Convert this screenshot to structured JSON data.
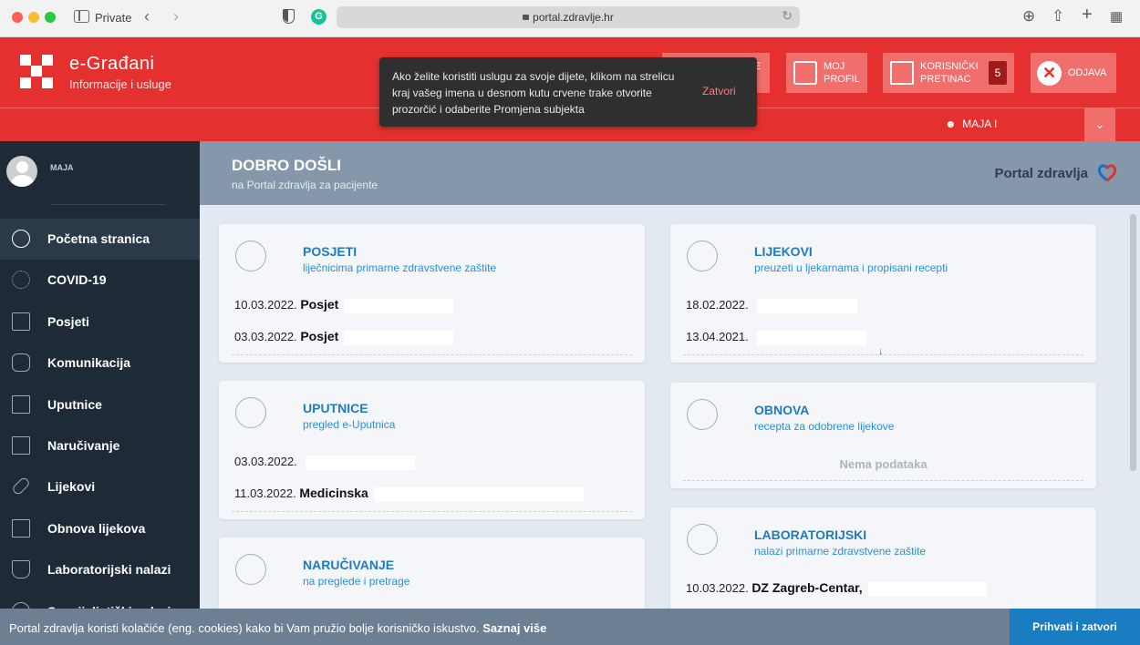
{
  "browser": {
    "private_label": "Private",
    "url": "portal.zdravlje.hr"
  },
  "header": {
    "app_name": "e-Građani",
    "app_subtitle": "Informacije i usluge",
    "hidden_button_label": "E",
    "profile_label": "MOJ\nPROFIL",
    "inbox_label": "KORISNIČKI\nPRETINAC",
    "inbox_count": "5",
    "logout_label": "ODJAVA",
    "user_name": "MAJA I"
  },
  "tooltip": {
    "message": "Ako želite koristiti uslugu za svoje dijete, klikom na strelicu kraj vašeg imena u desnom kutu crvene trake otvorite prozorčić i odaberite Promjena subjekta",
    "close_label": "Zatvori"
  },
  "sidebar": {
    "user_name": "MAJA",
    "items": [
      {
        "label": "Početna stranica",
        "icon": "pulse-icon"
      },
      {
        "label": "COVID-19",
        "icon": "virus-icon"
      },
      {
        "label": "Posjeti",
        "icon": "house-medical-icon"
      },
      {
        "label": "Komunikacija",
        "icon": "chat-icon"
      },
      {
        "label": "Uputnice",
        "icon": "document-icon"
      },
      {
        "label": "Naručivanje",
        "icon": "calendar-icon"
      },
      {
        "label": "Lijekovi",
        "icon": "pill-icon"
      },
      {
        "label": "Obnova lijekova",
        "icon": "prescription-renew-icon"
      },
      {
        "label": "Laboratorijski nalazi",
        "icon": "flask-icon"
      },
      {
        "label": "Specijalistički nalazi",
        "icon": "stethoscope-icon"
      }
    ]
  },
  "welcome": {
    "title": "DOBRO DOŠLI",
    "subtitle": "na Portal zdravlja za pacijente",
    "portal_name": "Portal zdravlja"
  },
  "cards": {
    "posjeti": {
      "title": "POSJETI",
      "subtitle": "liječnicima primarne zdravstvene zaštite",
      "rows": [
        {
          "date": "10.03.2022.",
          "text": "Posjet"
        },
        {
          "date": "03.03.2022.",
          "text": "Posjet"
        }
      ]
    },
    "lijekovi": {
      "title": "LIJEKOVI",
      "subtitle": "preuzeti u ljekarnama i propisani recepti",
      "rows": [
        {
          "date": "18.02.2022.",
          "text": ""
        },
        {
          "date": "13.04.2021.",
          "text": ""
        }
      ]
    },
    "uputnice": {
      "title": "UPUTNICE",
      "subtitle": "pregled e-Uputnica",
      "rows": [
        {
          "date": "03.03.2022.",
          "text": ""
        },
        {
          "date": "11.03.2022.",
          "text": "Medicinska"
        }
      ]
    },
    "obnova": {
      "title": "OBNOVA",
      "subtitle": "recepta za odobrene lijekove",
      "empty": "Nema podataka"
    },
    "narucivanje": {
      "title": "NARUČIVANJE",
      "subtitle": "na preglede i pretrage"
    },
    "laboratorijski": {
      "title": "LABORATORIJSKI",
      "subtitle": "nalazi primarne zdravstvene zaštite",
      "rows": [
        {
          "date": "10.03.2022.",
          "text": "DZ Zagreb-Centar,"
        }
      ]
    }
  },
  "cookie": {
    "text": "Portal zdravlja koristi kolačiće (eng. cookies) kako bi Vam pružio bolje korisničko iskustvo.",
    "link": "Saznaj više",
    "accept": "Prihvati i zatvori"
  },
  "colors": {
    "brand_red": "#e4312f",
    "sidebar_dark": "#1e2b37",
    "accent_blue": "#1f7bbf"
  }
}
